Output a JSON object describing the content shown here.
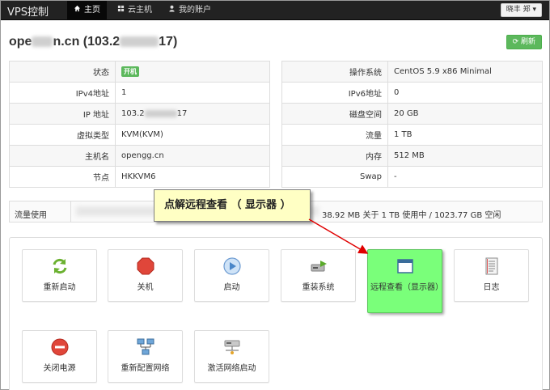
{
  "navbar": {
    "brand": "VPS控制",
    "items": [
      {
        "label": "主页",
        "icon": "home-icon",
        "active": true
      },
      {
        "label": "云主机",
        "icon": "grid-icon"
      },
      {
        "label": "我的账户",
        "icon": "user-icon"
      }
    ],
    "user": "晓丰 郑 ▾"
  },
  "header": {
    "title_prefix": "ope",
    "title_mid": "n.cn (103.2",
    "title_suffix": "17)",
    "refresh_label": "刷新"
  },
  "left_table": [
    {
      "key": "状态",
      "value": "开机",
      "badge": true
    },
    {
      "key": "IPv4地址",
      "value": "1"
    },
    {
      "key": "IP 地址",
      "value_prefix": "103.2",
      "value_suffix": "17"
    },
    {
      "key": "虚拟类型",
      "value": "KVM(KVM)"
    },
    {
      "key": "主机名",
      "value": "opengg.cn"
    },
    {
      "key": "节点",
      "value": "HKKVM6"
    }
  ],
  "right_table": [
    {
      "key": "操作系统",
      "value": "CentOS 5.9 x86 Minimal"
    },
    {
      "key": "IPv6地址",
      "value": "0"
    },
    {
      "key": "磁盘空间",
      "value": "20 GB"
    },
    {
      "key": "流量",
      "value": "1 TB"
    },
    {
      "key": "内存",
      "value": "512 MB"
    },
    {
      "key": "Swap",
      "value": "-"
    }
  ],
  "traffic": {
    "label": "流量使用",
    "value": "38.92 MB 关于 1 TB 使用中 / 1023.77 GB 空闲"
  },
  "callout": "点解远程查看 （ 显示器 ）",
  "actions": [
    {
      "label": "重新启动",
      "icon": "reboot-icon"
    },
    {
      "label": "关机",
      "icon": "stop-icon"
    },
    {
      "label": "启动",
      "icon": "play-icon"
    },
    {
      "label": "重装系统",
      "icon": "reinstall-icon"
    },
    {
      "label": "远程查看（显示器）",
      "icon": "console-icon"
    },
    {
      "label": "日志",
      "icon": "log-icon"
    },
    {
      "label": "关闭电源",
      "icon": "power-off-icon"
    },
    {
      "label": "重新配置网络",
      "icon": "network-icon"
    },
    {
      "label": "激活网络启动",
      "icon": "netboot-icon"
    }
  ],
  "colors": {
    "navbar_bg": "#222222",
    "success": "#5cb85c",
    "highlight": "#7aff7a",
    "callout_bg": "#ffffc4",
    "arrow": "#e00000"
  }
}
